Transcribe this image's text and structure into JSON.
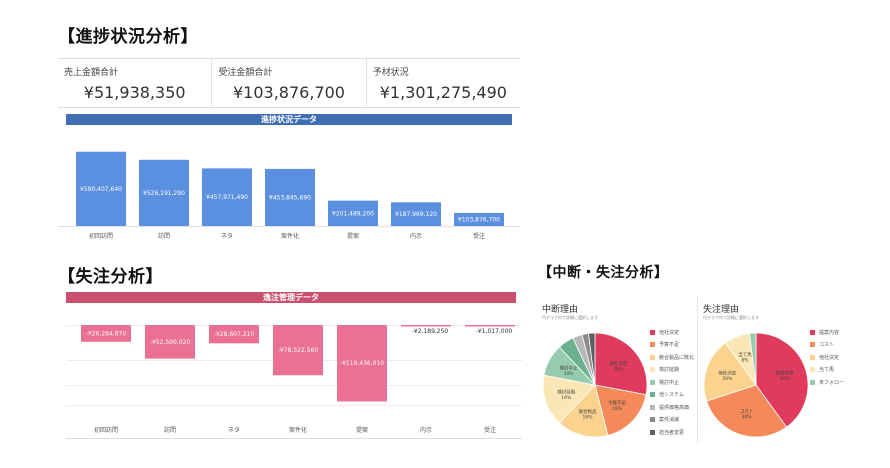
{
  "progress": {
    "title": "【進捗状況分析】",
    "kpis": [
      {
        "label": "売上金額合計",
        "value": "¥51,938,350"
      },
      {
        "label": "受注金額合計",
        "value": "¥103,876,700"
      },
      {
        "label": "予材状況",
        "value": "¥1,301,275,490"
      }
    ],
    "banner": "進捗状況データ",
    "chart_color": "#5b8fe0",
    "banner_color": "#3f6fb2"
  },
  "lost": {
    "title": "【失注分析】",
    "banner": "逸注管理データ",
    "chart_color": "#ec6f95",
    "banner_color": "#c9506f"
  },
  "breakdown": {
    "title": "【中断・失注分析】",
    "pies": [
      {
        "title": "中断理由",
        "subtitle": "円グラフ内で詳細に選択します"
      },
      {
        "title": "失注理由",
        "subtitle": "円グラフ内で詳細に選択します"
      }
    ]
  },
  "chart_data": [
    {
      "type": "bar",
      "categories": [
        "初回訪問",
        "訪問",
        "ネタ",
        "案件化",
        "提案",
        "内示",
        "受注"
      ],
      "values": [
        590407640,
        526191290,
        457971490,
        453845690,
        201489200,
        187969120,
        103876700
      ],
      "labels": [
        "¥590,407,640",
        "¥526,191,290",
        "¥457,971,490",
        "¥453,845,690",
        "¥201,489,200",
        "¥187,969,120",
        "¥103,876,700"
      ],
      "ylim": [
        0,
        620000000
      ]
    },
    {
      "type": "bar",
      "categories": [
        "初回訪問",
        "訪問",
        "ネタ",
        "案件化",
        "提案",
        "内示",
        "受注"
      ],
      "values": [
        -26264870,
        -52500020,
        -28607210,
        -78522560,
        -119436010,
        -2189250,
        -1017000
      ],
      "labels": [
        "-¥26,264,870",
        "-¥52,500,020",
        "-¥28,607,210",
        "-¥78,522,560",
        "-¥119,436,010",
        "-¥2,189,250",
        "-¥1,017,000"
      ],
      "ylim": [
        -125000000,
        0
      ]
    },
    {
      "type": "pie",
      "title": "中断理由",
      "slices": [
        {
          "name": "他社決定",
          "value": 28,
          "label": "他社決定\n28%",
          "color": "#e03a5c"
        },
        {
          "name": "予算不足",
          "value": 18,
          "label": "予算不足\n18%",
          "color": "#f48a5a"
        },
        {
          "name": "競合製品に敗北",
          "value": 16,
          "label": "競合製品\n16%",
          "color": "#fbd38f"
        },
        {
          "name": "検討延期",
          "value": 16,
          "label": "検討延期\n16%",
          "color": "#fbe7b5"
        },
        {
          "name": "検討中止",
          "value": 10,
          "label": "検討中止\n10%",
          "color": "#96cbb0"
        },
        {
          "name": "他システム",
          "value": 5,
          "label": "",
          "color": "#6db08f"
        },
        {
          "name": "提供価格高価",
          "value": 3,
          "label": "",
          "color": "#b7b7b7"
        },
        {
          "name": "案件消滅",
          "value": 2,
          "label": "",
          "color": "#8a8a8a"
        },
        {
          "name": "担当者変更",
          "value": 2,
          "label": "",
          "color": "#5e5e5e"
        }
      ]
    },
    {
      "type": "pie",
      "title": "失注理由",
      "slices": [
        {
          "name": "提案内容",
          "value": 40,
          "label": "提案内容\n40%",
          "color": "#e03a5c"
        },
        {
          "name": "コスト",
          "value": 30,
          "label": "コスト\n30%",
          "color": "#f48a5a"
        },
        {
          "name": "他社決定",
          "value": 20,
          "label": "他社決定\n20%",
          "color": "#fbd38f"
        },
        {
          "name": "当て馬",
          "value": 8,
          "label": "当て馬\n8%",
          "color": "#fbe7b5"
        },
        {
          "name": "未フォロー",
          "value": 2,
          "label": "",
          "color": "#96cbb0"
        }
      ]
    }
  ]
}
